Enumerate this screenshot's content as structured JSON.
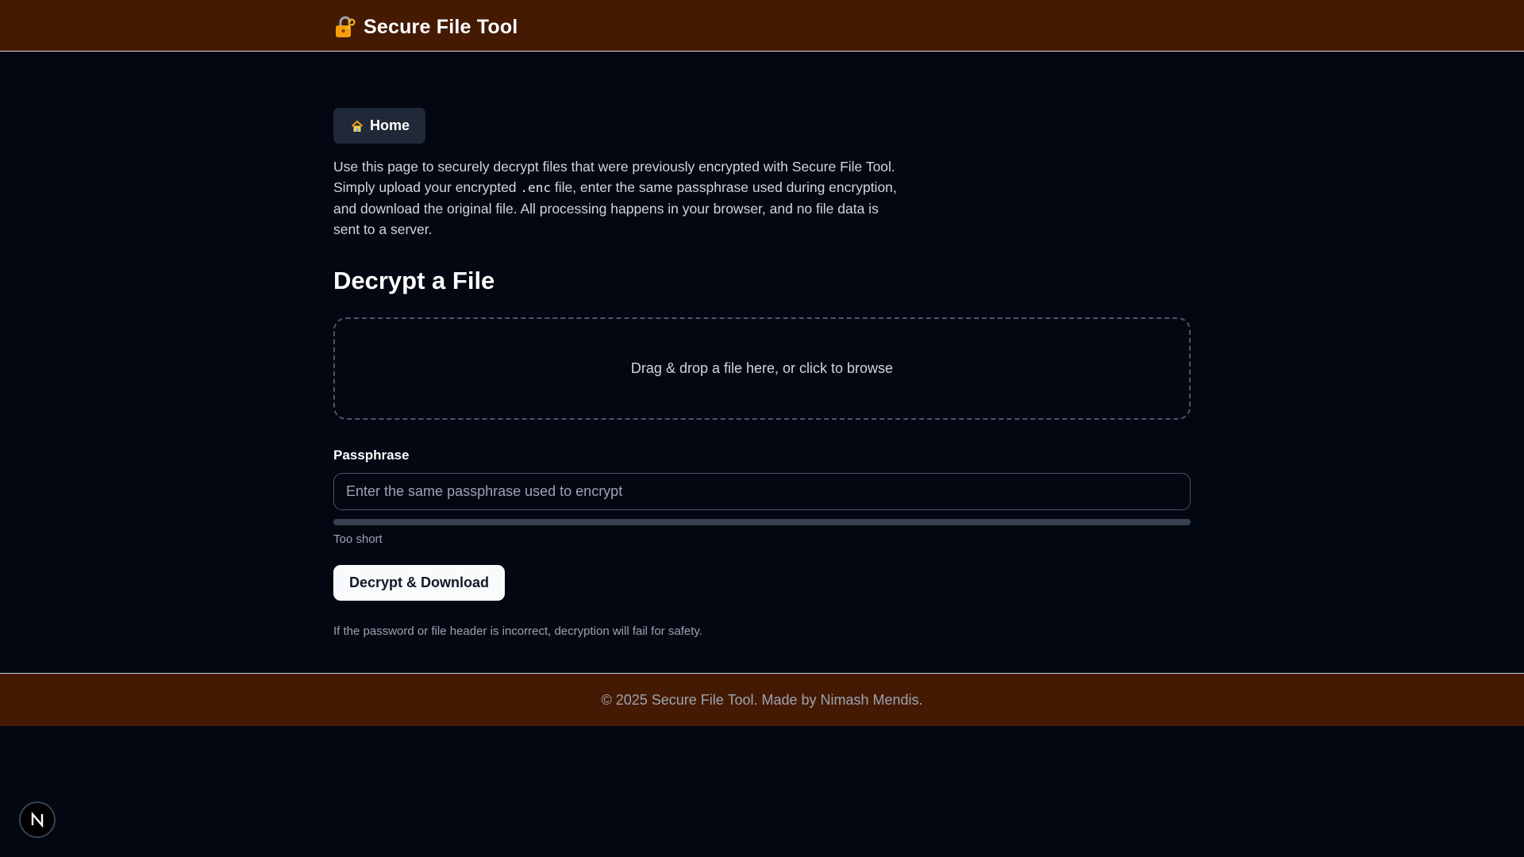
{
  "header": {
    "title": "Secure File Tool",
    "logo_icon": "lock-key-icon"
  },
  "nav": {
    "home_label": "Home",
    "home_icon": "house-icon"
  },
  "intro": {
    "text_before": "Use this page to securely decrypt files that were previously encrypted with Secure File Tool. Simply upload your encrypted",
    "code": ".enc",
    "text_after": "file, enter the same passphrase used during encryption, and download the original file. All processing happens in your browser, and no file data is sent to a server."
  },
  "decrypt": {
    "heading": "Decrypt a File",
    "dropzone_text": "Drag & drop a file here, or click to browse",
    "passphrase_label": "Passphrase",
    "passphrase_value": "",
    "passphrase_placeholder": "Enter the same passphrase used to encrypt",
    "strength_level": 0,
    "strength_text": "Too short",
    "button_label": "Decrypt & Download",
    "safety_note": "If the password or file header is incorrect, decryption will fail for safety."
  },
  "footer": {
    "text": "© 2025 Secure File Tool. Made by Nimash Mendis."
  },
  "dev_badge": {
    "label": "N"
  },
  "colors": {
    "header_bg": "#451a03",
    "page_bg": "#030712",
    "button_bg": "#f9fafb"
  }
}
